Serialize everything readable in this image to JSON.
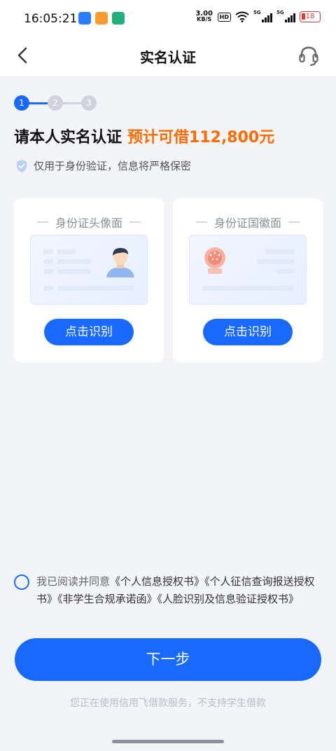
{
  "status_bar": {
    "time": "16:05:21",
    "net_speed_value": "3.00",
    "net_speed_unit": "KB/S",
    "hd_label": "HD",
    "signal1_label": "5G",
    "signal2_label": "5G",
    "battery": "18",
    "battery_color": "#e53935"
  },
  "nav": {
    "title": "实名认证",
    "back_icon": "chevron-left-icon",
    "service_icon": "headset-icon"
  },
  "steps": [
    "1",
    "2",
    "3"
  ],
  "active_step": 1,
  "headline": {
    "main": "请本人实名认证",
    "highlight": "预计可借112,800元",
    "highlight_color": "#ff6a00"
  },
  "notice": {
    "icon": "shield-check-icon",
    "text": "仅用于身份验证，信息将严格保密"
  },
  "cards": [
    {
      "title": "身份证头像面",
      "button": "点击识别"
    },
    {
      "title": "身份证国徽面",
      "button": "点击识别"
    }
  ],
  "agreement": {
    "prefix": "我已阅读并同意",
    "links": [
      "《个人信息授权书》",
      "《个人征信查询报送授权书》",
      "《非学生合规承诺函》",
      "《人脸识别及信息验证授权书》"
    ]
  },
  "next_button": "下一步",
  "footer_note": "您正在使用信用飞借款服务，不支持学生借款",
  "accent_color": "#1769ff"
}
